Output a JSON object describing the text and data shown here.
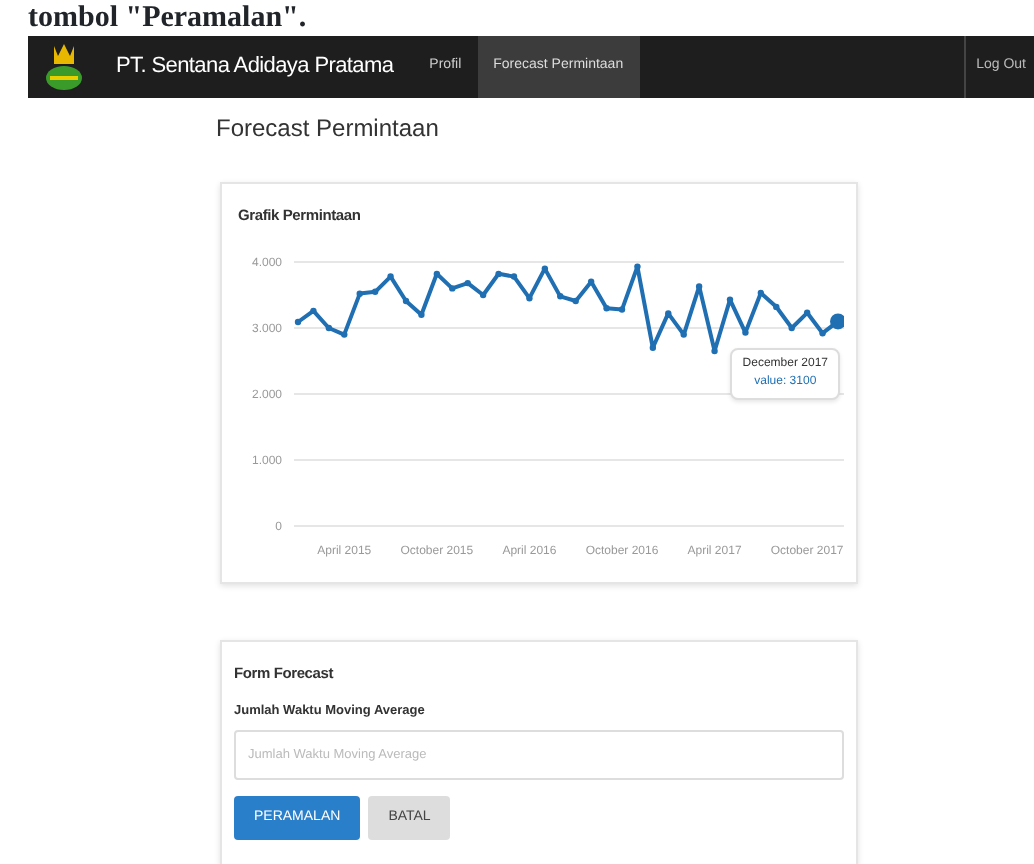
{
  "caption": "tombol \"Peramalan\".",
  "navbar": {
    "brand": "PT. Sentana Adidaya Pratama",
    "links": [
      {
        "label": "Profil",
        "selected": false
      },
      {
        "label": "Forecast Permintaan",
        "selected": true
      }
    ],
    "logout": "Log Out"
  },
  "page_title": "Forecast Permintaan",
  "chart_card": {
    "title": "Grafik Permintaan",
    "chart_data": {
      "type": "line",
      "categories": [
        null,
        null,
        null,
        "April 2015",
        null,
        null,
        null,
        null,
        null,
        "October 2015",
        null,
        null,
        null,
        null,
        null,
        "April 2016",
        null,
        null,
        null,
        null,
        null,
        "October 2016",
        null,
        null,
        null,
        null,
        null,
        "April 2017",
        null,
        null,
        null,
        null,
        null,
        "October 2017",
        null,
        null
      ],
      "grid": true,
      "series": [
        {
          "color": "#1f6fb2",
          "marker": true,
          "values": [
            3090,
            3260,
            3000,
            2900,
            3520,
            3550,
            3780,
            3410,
            3200,
            3820,
            3600,
            3680,
            3500,
            3820,
            3780,
            3450,
            3900,
            3480,
            3410,
            3700,
            3300,
            3280,
            3930,
            2700,
            3220,
            2900,
            3630,
            2650,
            3430,
            2930,
            3530,
            3320,
            3000,
            3230,
            2920,
            3100
          ]
        }
      ],
      "ylim": [
        0,
        4000
      ],
      "yticks": [
        {
          "value": 0,
          "label": "0"
        },
        {
          "value": 1000,
          "label": "1.000"
        },
        {
          "value": 2000,
          "label": "2.000"
        },
        {
          "value": 3000,
          "label": "3.000"
        },
        {
          "value": 4000,
          "label": "4.000"
        }
      ]
    },
    "tooltip": {
      "title": "December 2017",
      "text": "value: 3100"
    }
  },
  "form_card": {
    "title": "Form Forecast",
    "field_label": "Jumlah Waktu Moving Average",
    "placeholder": "Jumlah Waktu Moving Average",
    "buttons": [
      {
        "label": "PERAMALAN",
        "kind": "primary"
      },
      {
        "label": "BATAL",
        "kind": "secondary"
      }
    ]
  }
}
